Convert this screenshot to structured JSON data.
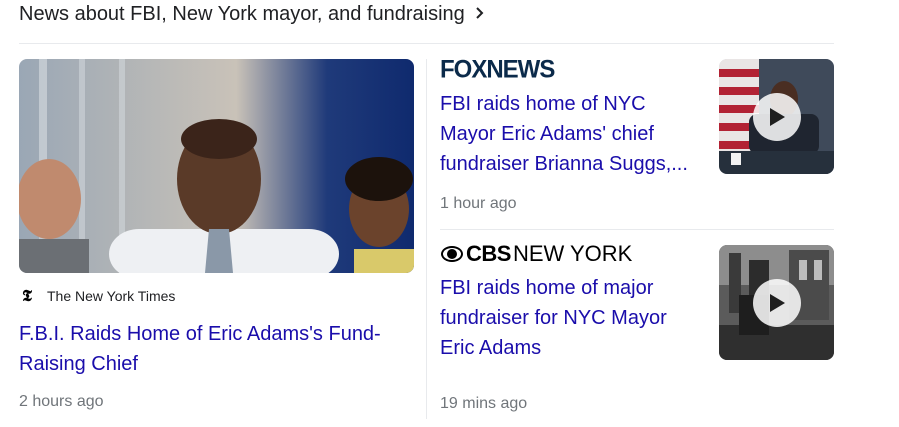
{
  "section": {
    "heading": "News about FBI, New York mayor, and fundraising",
    "chevron_icon": "chevron-right-icon"
  },
  "main_article": {
    "source": "The New York Times",
    "source_logo_text": "𝕿",
    "title": "F.B.I. Raids Home of Eric Adams's Fund-Raising Chief",
    "time": "2 hours ago",
    "image": "photo-eric-adams"
  },
  "side_articles": [
    {
      "source_logo": "FOXNEWS",
      "title": "FBI raids home of NYC Mayor Eric Adams' chief fundraiser Brianna Suggs,...",
      "time": "1 hour ago",
      "thumbnail": "video-thumbnail",
      "play_icon": "play-icon"
    },
    {
      "source_logo_bold": "CBS",
      "source_logo_rest": "NEW YORK",
      "title": "FBI raids home of major fundraiser for NYC Mayor Eric Adams",
      "time": "19 mins ago",
      "thumbnail": "video-thumbnail",
      "play_icon": "play-icon"
    }
  ],
  "colors": {
    "link": "#1a0dab",
    "meta": "#70757a",
    "divider": "#e8eaed"
  }
}
